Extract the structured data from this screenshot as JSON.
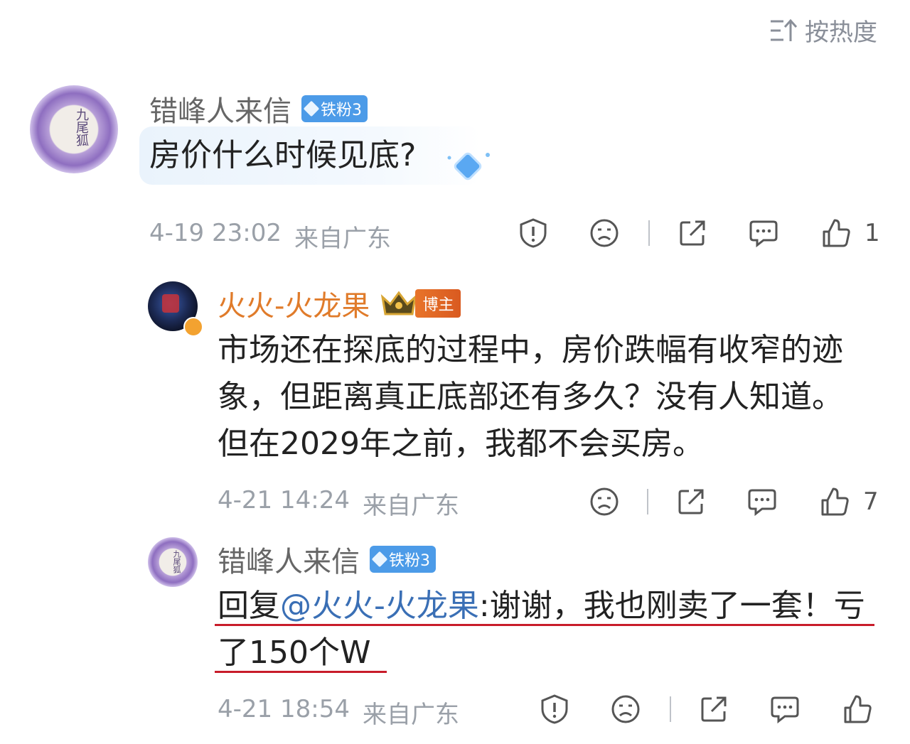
{
  "sort": {
    "label": "按热度"
  },
  "comments": [
    {
      "username": "错峰人来信",
      "badge": "铁粉3",
      "avatar_text": "九尾狐",
      "text": "房价什么时候见底?",
      "time": "4-19 23:02",
      "location": "来自广东",
      "likes": "1"
    },
    {
      "username": "火火-火龙果",
      "badge": "博主",
      "text_lines": [
        "市场还在探底的过程中，房价跌幅有收窄的迹",
        "象，但距离真正底部还有多久？没有人知道。",
        "但在2029年之前，我都不会买房。"
      ],
      "time": "4-21 14:24",
      "location": "来自广东",
      "likes": "7"
    },
    {
      "username": "错峰人来信",
      "badge": "铁粉3",
      "avatar_text": "九尾狐",
      "reply_prefix": "回复",
      "mention": "@火火-火龙果",
      "reply_line1": ":谢谢，我也刚卖了一套！亏",
      "reply_line2": "了150个W",
      "time": "4-21 18:54",
      "location": "来自广东"
    }
  ],
  "colors": {
    "underline": "#c81c2a",
    "mention": "#3a6fb5",
    "blogger_name": "#e07b2a",
    "fan_badge": "#4c9be8"
  }
}
